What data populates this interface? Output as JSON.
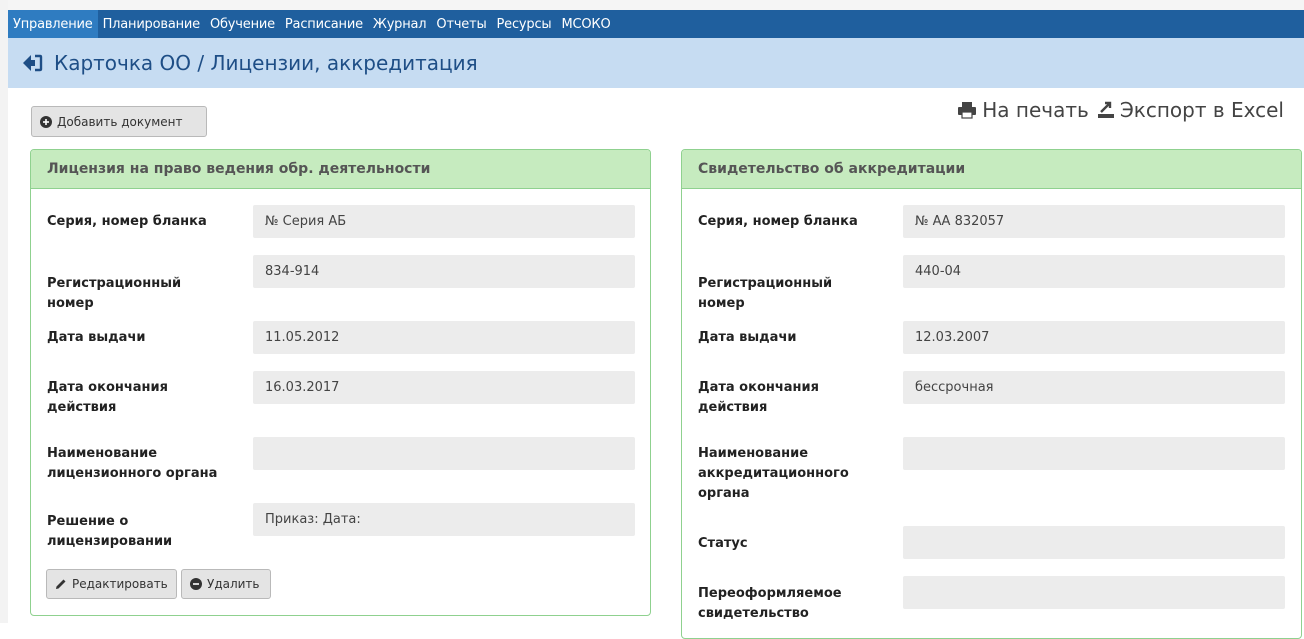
{
  "nav": {
    "items": [
      {
        "label": "Управление",
        "active": true
      },
      {
        "label": "Планирование",
        "active": false
      },
      {
        "label": "Обучение",
        "active": false
      },
      {
        "label": "Расписание",
        "active": false
      },
      {
        "label": "Журнал",
        "active": false
      },
      {
        "label": "Отчеты",
        "active": false
      },
      {
        "label": "Ресурсы",
        "active": false
      },
      {
        "label": "МСОКО",
        "active": false
      }
    ]
  },
  "header": {
    "title": "Карточка ОО / Лицензии, аккредитация",
    "back_icon": "arrow-left-icon"
  },
  "toolbar": {
    "add_label": "Добавить документ",
    "print_label": "На печать",
    "export_label": "Экспорт в Excel"
  },
  "license": {
    "title": "Лицензия на право ведения обр. деятельности",
    "fields": [
      {
        "label": "Серия, номер бланка",
        "value": "№ Серия АБ"
      },
      {
        "label": "Регистрационный номер",
        "value": "834-914"
      },
      {
        "label": "Дата выдачи",
        "value": "11.05.2012"
      },
      {
        "label": "Дата окончания действия",
        "value": "16.03.2017"
      },
      {
        "label": "Наименование лицензионного органа",
        "value": ""
      },
      {
        "label": "Решение о лицензировании",
        "value": "Приказ:  Дата:"
      }
    ],
    "edit_label": "Редактировать",
    "delete_label": "Удалить"
  },
  "accreditation": {
    "title": "Свидетельство об аккредитации",
    "fields": [
      {
        "label": "Серия, номер бланка",
        "value": "№ АА 832057"
      },
      {
        "label": "Регистрационный номер",
        "value": "440-04"
      },
      {
        "label": "Дата выдачи",
        "value": "12.03.2007"
      },
      {
        "label": "Дата окончания действия",
        "value": "бессрочная"
      },
      {
        "label": "Наименование аккредитационного органа",
        "value": ""
      },
      {
        "label": "Статус",
        "value": ""
      },
      {
        "label": "Переоформляемое свидетельство",
        "value": ""
      }
    ]
  },
  "colors": {
    "navbar": "#1f5f9e",
    "nav_active": "#2f7cc1",
    "titlebar": "#c6dcf2",
    "panel_header": "#c6ebbf",
    "panel_border": "#8fd18f",
    "field_bg": "#ececec"
  }
}
